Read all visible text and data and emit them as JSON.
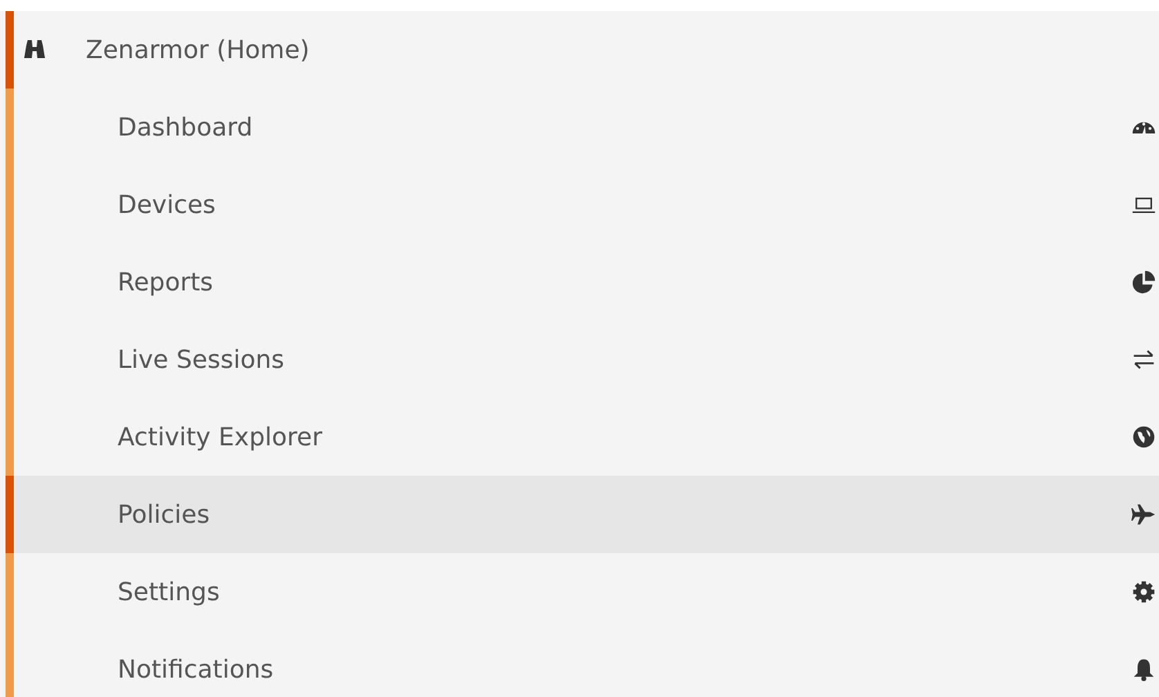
{
  "menu": {
    "title": "Zenarmor (Home)",
    "expanded": true,
    "items": [
      {
        "label": "Dashboard",
        "selected": false
      },
      {
        "label": "Devices",
        "selected": false
      },
      {
        "label": "Reports",
        "selected": false
      },
      {
        "label": "Live Sessions",
        "selected": false
      },
      {
        "label": "Activity Explorer",
        "selected": false
      },
      {
        "label": "Policies",
        "selected": true
      },
      {
        "label": "Settings",
        "selected": false
      },
      {
        "label": "Notifications",
        "selected": false
      }
    ]
  }
}
